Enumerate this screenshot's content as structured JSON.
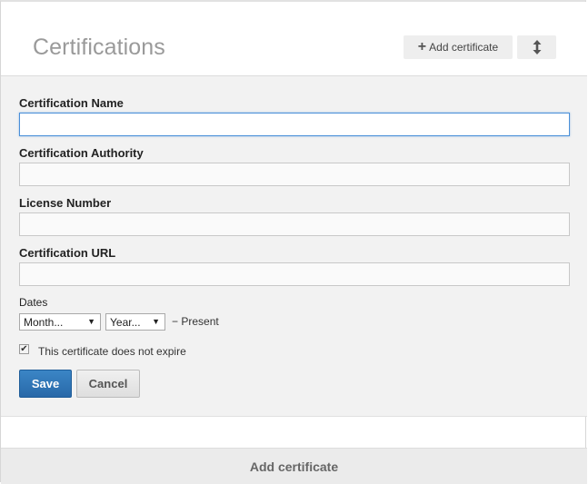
{
  "header": {
    "title": "Certifications",
    "add_button": {
      "icon": "plus-icon",
      "label": "Add certificate"
    },
    "reorder_button": {
      "icon": "up-down-arrow-icon"
    }
  },
  "form": {
    "certification_name": {
      "label": "Certification Name",
      "value": "",
      "placeholder": ""
    },
    "certification_authority": {
      "label": "Certification Authority",
      "value": "",
      "placeholder": ""
    },
    "license_number": {
      "label": "License Number",
      "value": "",
      "placeholder": ""
    },
    "certification_url": {
      "label": "Certification URL",
      "value": "",
      "placeholder": ""
    },
    "dates": {
      "label": "Dates",
      "month_select": "Month...",
      "year_select": "Year...",
      "end_text": "− Present"
    },
    "no_expire": {
      "label": "This certificate does not expire",
      "checked": true
    },
    "save_label": "Save",
    "cancel_label": "Cancel"
  },
  "footer": {
    "add_label": "Add certificate"
  },
  "colors": {
    "save_blue": "#2f76b7",
    "focus_border": "#4a90d9",
    "form_background": "#f2f2f2"
  }
}
